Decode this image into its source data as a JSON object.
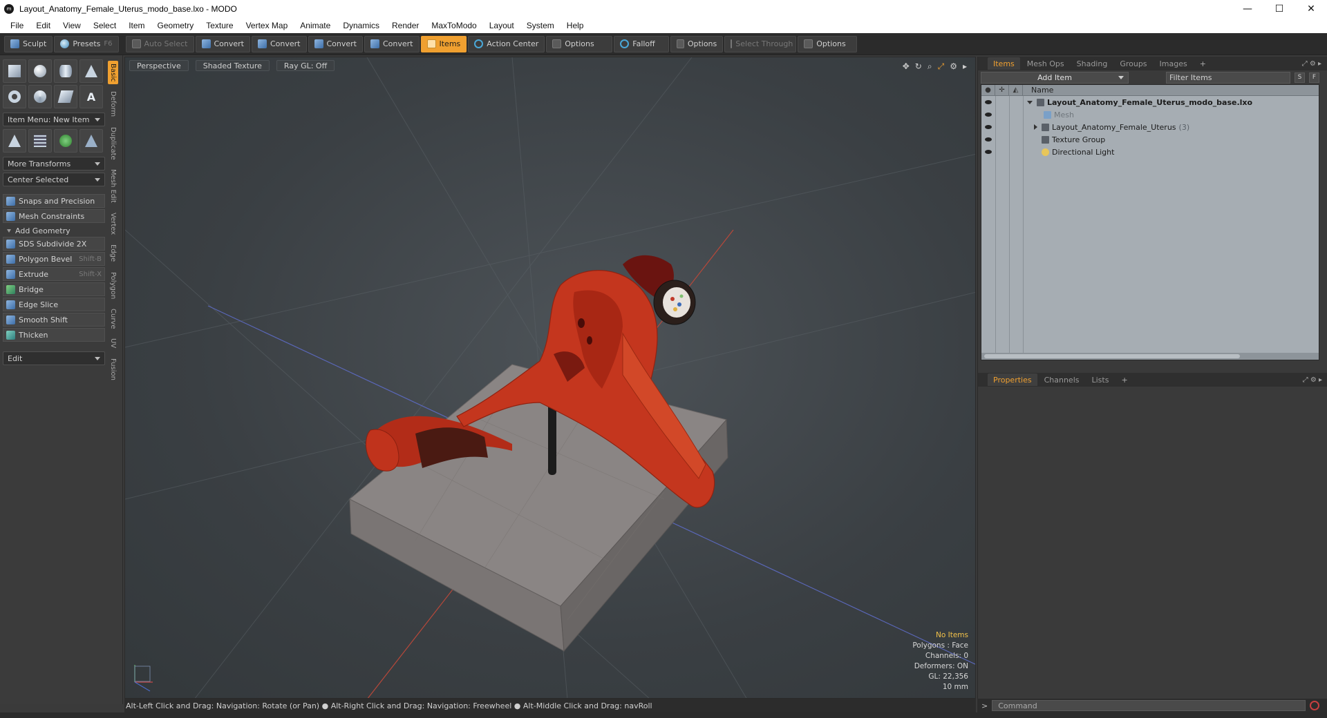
{
  "window": {
    "title": "Layout_Anatomy_Female_Uterus_modo_base.lxo - MODO",
    "controls": {
      "minimize": "—",
      "maximize": "☐",
      "close": "✕"
    }
  },
  "menu": [
    "File",
    "Edit",
    "View",
    "Select",
    "Item",
    "Geometry",
    "Texture",
    "Vertex Map",
    "Animate",
    "Dynamics",
    "Render",
    "MaxToModo",
    "Layout",
    "System",
    "Help"
  ],
  "toolbar": {
    "sculpt": "Sculpt",
    "presets": "Presets",
    "presets_shortcut": "F6",
    "auto_select": "Auto Select",
    "convert1": "Convert",
    "convert2": "Convert",
    "convert3": "Convert",
    "convert4": "Convert",
    "items": "Items",
    "action_center": "Action Center",
    "options1": "Options",
    "falloff": "Falloff",
    "options2": "Options",
    "select_through": "Select Through",
    "options3": "Options"
  },
  "left_panel": {
    "item_menu": "Item Menu: New Item",
    "more_transforms": "More Transforms",
    "center_selected": "Center Selected",
    "snaps": "Snaps and Precision",
    "mesh_constraints": "Mesh Constraints",
    "add_geometry": "Add Geometry",
    "tools": [
      {
        "label": "SDS Subdivide 2X",
        "shortcut": ""
      },
      {
        "label": "Polygon Bevel",
        "shortcut": "Shift-B"
      },
      {
        "label": "Extrude",
        "shortcut": "Shift-X"
      },
      {
        "label": "Bridge",
        "shortcut": ""
      },
      {
        "label": "Edge Slice",
        "shortcut": ""
      },
      {
        "label": "Smooth Shift",
        "shortcut": ""
      },
      {
        "label": "Thicken",
        "shortcut": ""
      }
    ],
    "edit_dropdown": "Edit",
    "vertical_tabs": [
      "Basic",
      "Deform",
      "Duplicate",
      "Mesh Edit",
      "Vertex",
      "Edge",
      "Polygon",
      "Curve",
      "UV",
      "Fusion"
    ]
  },
  "viewport": {
    "tabs": [
      "Perspective",
      "Shaded Texture",
      "Ray GL: Off"
    ],
    "stats": {
      "items": "No Items",
      "polygons": "Polygons : Face",
      "channels": "Channels: 0",
      "deformers": "Deformers: ON",
      "gl": "GL: 22,356",
      "scale": "10 mm"
    }
  },
  "status_bar": "Alt-Left Click and Drag: Navigation: Rotate (or Pan) ● Alt-Right Click and Drag: Navigation: Freewheel ● Alt-Middle Click and Drag: navRoll",
  "items_panel": {
    "tabs": [
      "Items",
      "Mesh Ops",
      "Shading",
      "Groups",
      "Images",
      "+"
    ],
    "add_item": "Add Item",
    "filter_placeholder": "Filter Items",
    "s_btn": "S",
    "f_btn": "F",
    "name_header": "Name",
    "tree": [
      {
        "label": "Layout_Anatomy_Female_Uterus_modo_base.lxo",
        "count": ""
      },
      {
        "label": "Mesh",
        "count": ""
      },
      {
        "label": "Layout_Anatomy_Female_Uterus",
        "count": "(3)"
      },
      {
        "label": "Texture Group",
        "count": ""
      },
      {
        "label": "Directional Light",
        "count": ""
      }
    ]
  },
  "properties_panel": {
    "tabs": [
      "Properties",
      "Channels",
      "Lists",
      "+"
    ]
  },
  "command": {
    "prompt": ">",
    "placeholder": "Command"
  },
  "colors": {
    "accent": "#f0a030",
    "viewport_bg": "#42484c",
    "model_red": "#c0301a",
    "tree_bg": "#a6adb3"
  }
}
